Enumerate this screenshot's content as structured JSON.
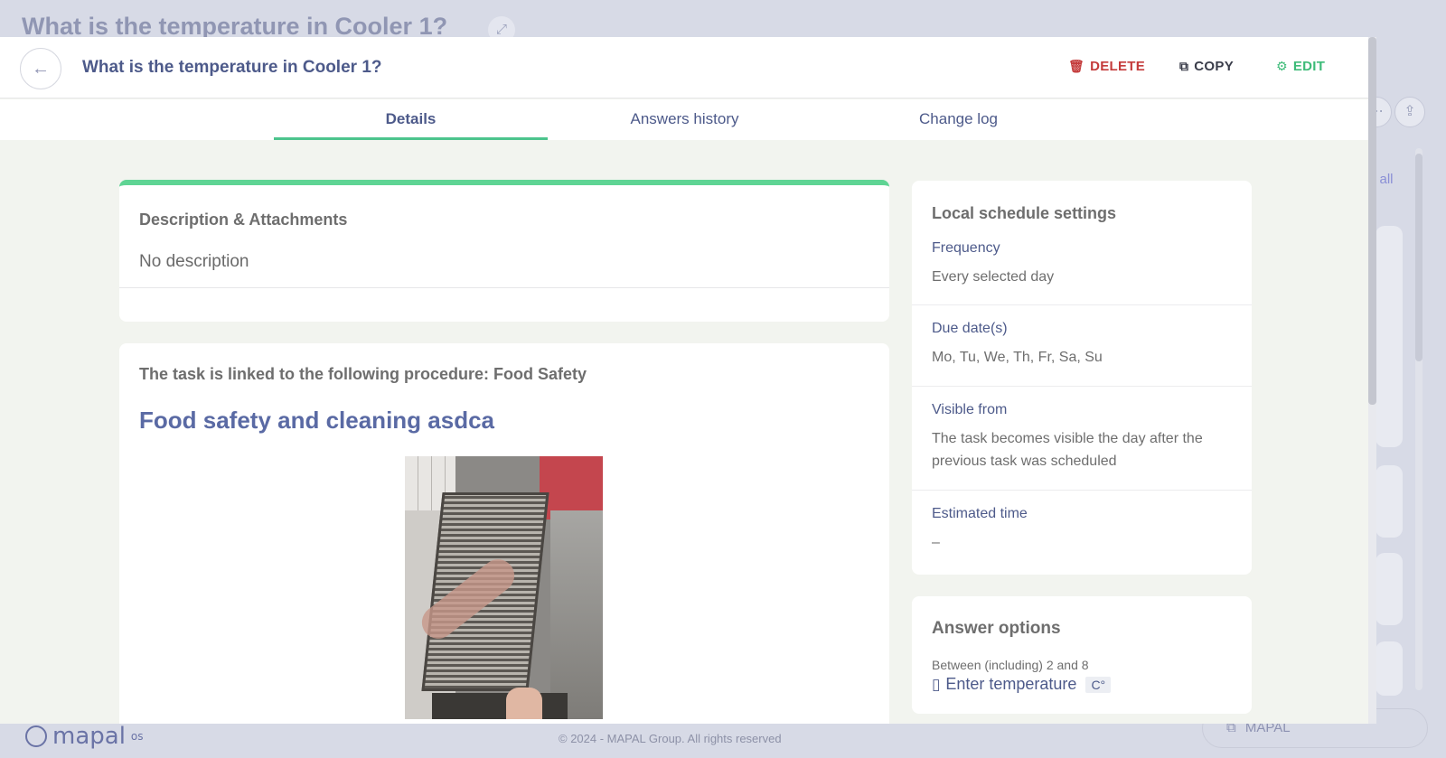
{
  "background": {
    "title": "What is the temperature in Cooler 1?",
    "expand_icon": "expand-icon",
    "see_all_link": "e all",
    "logo_text": "mapal",
    "logo_superscript": "os",
    "copyright": "© 2024 - MAPAL Group. All rights reserved",
    "mapal_button_label": "MAPAL"
  },
  "modal": {
    "title": "What is the temperature in Cooler 1?",
    "actions": {
      "delete_label": "DELETE",
      "copy_label": "COPY",
      "edit_label": "EDIT"
    },
    "tabs": [
      {
        "label": "Details",
        "active": true
      },
      {
        "label": "Answers history",
        "active": false
      },
      {
        "label": "Change log",
        "active": false
      }
    ]
  },
  "description_card": {
    "heading": "Description & Attachments",
    "body": "No description"
  },
  "procedure_card": {
    "linked_text": "The task is linked to the following procedure: Food Safety",
    "title": "Food safety and cleaning asdca"
  },
  "schedule_card": {
    "heading": "Local schedule settings",
    "sections": [
      {
        "label": "Frequency",
        "value": "Every selected day"
      },
      {
        "label": "Due date(s)",
        "value": "Mo, Tu, We, Th, Fr, Sa, Su"
      },
      {
        "label": "Visible from",
        "value": "The task becomes visible the day after the previous task was scheduled"
      },
      {
        "label": "Estimated time",
        "value": "–"
      }
    ]
  },
  "answer_card": {
    "heading": "Answer options",
    "range_text": "Between (including) 2 and 8",
    "input_placeholder": "Enter temperature",
    "unit": "C°"
  },
  "colors": {
    "accent_green": "#4cc48d",
    "delete_red": "#c43b3b",
    "edit_green": "#3dbb78",
    "title_blue": "#4d5a8a"
  }
}
